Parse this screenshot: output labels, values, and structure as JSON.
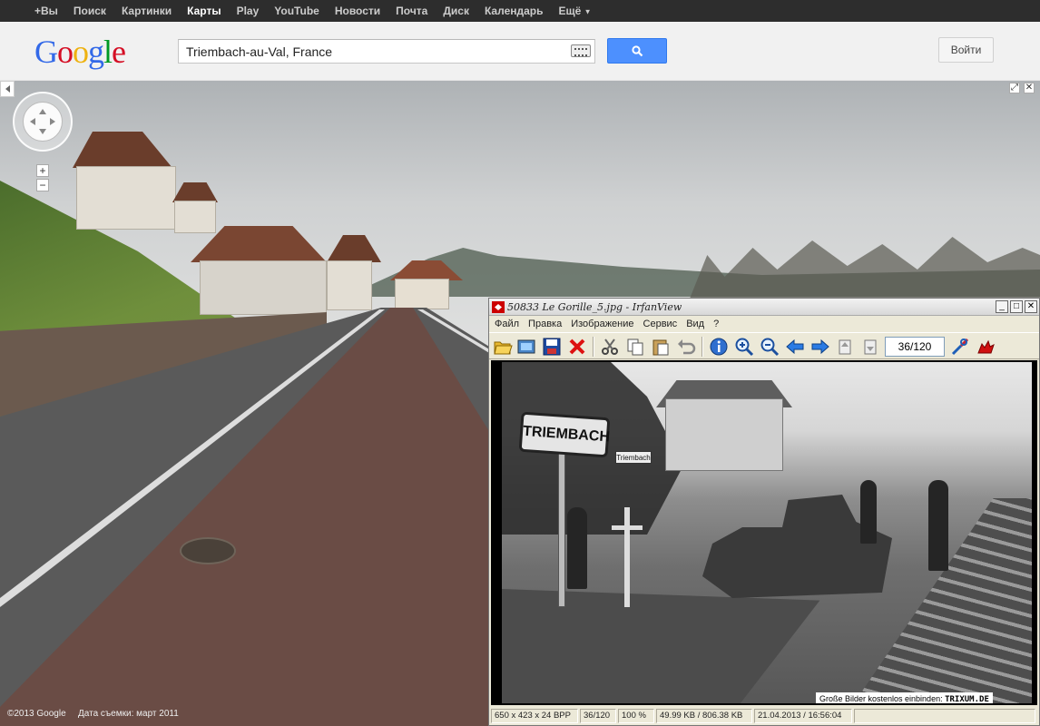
{
  "gbar": {
    "items": [
      "+Вы",
      "Поиск",
      "Картинки",
      "Карты",
      "Play",
      "YouTube",
      "Новости",
      "Почта",
      "Диск",
      "Календарь",
      "Ещё"
    ],
    "active": "Карты"
  },
  "header": {
    "logo": "Google",
    "search_value": "Triembach-au-Val, France",
    "login_label": "Войти"
  },
  "streetview": {
    "copyright": "©2013 Google",
    "capture_date": "Дата съемки: март 2011"
  },
  "irfanview": {
    "title": "50833 Le Gorille_5.jpg - IrfanView",
    "menu": [
      "Файл",
      "Правка",
      "Изображение",
      "Сервис",
      "Вид",
      "?"
    ],
    "page_counter": "36/120",
    "photo_sign": "TRIEMBACH",
    "photo_small_sign": "Triembach",
    "watermark_text": "Große Bilder kostenlos einbinden:",
    "watermark_brand": "TRIXUM.DE",
    "status": {
      "dimensions": "650 x 423 x 24 BPP",
      "index": "36/120",
      "zoom": "100 %",
      "size": "49.99 KB / 806.38 KB",
      "datetime": "21.04.2013 / 16:56:04"
    }
  }
}
